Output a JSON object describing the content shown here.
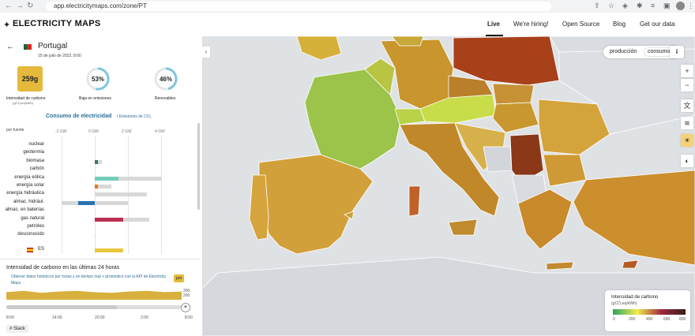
{
  "browser": {
    "url": "app.electricitymaps.com/zone/PT"
  },
  "topnav": {
    "logo": "ELECTRICITY MAPS",
    "links": [
      "Live",
      "We're hiring!",
      "Open Source",
      "Blog",
      "Get our data"
    ]
  },
  "zone": {
    "name": "Portugal",
    "date": "15 de julio de 2022, 8:00"
  },
  "metrics": {
    "carbon_value": "259g",
    "carbon_label": "Intensidad de carbono",
    "carbon_unit": "(gCO₂eq/kWh)",
    "lowcarbon_value": "53%",
    "lowcarbon_label": "Baja en emisiones",
    "lowcarbon_fraction": 0.53,
    "renewable_value": "46%",
    "renewable_label": "Renovables",
    "renewable_fraction": 0.46
  },
  "consumption": {
    "title": "Consumo de electricidad",
    "emissions_link": "| Emisiones de CO₂",
    "by_source": "por fuente",
    "ticks": [
      "-2 GW",
      "0 GW",
      "2 GW",
      "4 GW"
    ],
    "sources": [
      {
        "label": "nuclear",
        "value": 0,
        "capacity": 0,
        "color": "#888"
      },
      {
        "label": "geotermia",
        "value": 0,
        "capacity": 0,
        "color": "#888"
      },
      {
        "label": "biomasa",
        "value": 0.2,
        "capacity": 0.45,
        "color": "#3d7a5f"
      },
      {
        "label": "carbón",
        "value": 0,
        "capacity": 0,
        "color": "#888"
      },
      {
        "label": "energía eólica",
        "value": 1.45,
        "capacity": 4.0,
        "color": "#74cdb9"
      },
      {
        "label": "energía solar",
        "value": 0.18,
        "capacity": 1.0,
        "color": "#f27406"
      },
      {
        "label": "energía hidráulica",
        "value": 0,
        "capacity": 3.15,
        "color": "#2772b2"
      },
      {
        "label": "almac. hidrául.",
        "value": -1.0,
        "capacity": 2.0,
        "neg_capacity": -2.0,
        "color": "#2772b2"
      },
      {
        "label": "almac. en baterías",
        "value": 0,
        "capacity": 0,
        "color": "#888"
      },
      {
        "label": "gas natural",
        "value": 1.7,
        "capacity": 3.3,
        "color": "#bb2f51"
      },
      {
        "label": "petróleo",
        "value": 0,
        "capacity": 0,
        "color": "#888"
      },
      {
        "label": "desconocido",
        "value": 0,
        "capacity": 0.05,
        "color": "#888"
      }
    ],
    "import_label": "ES",
    "import_value": 1.7
  },
  "history": {
    "title": "Intensidad de carbono en las últimas 24 horas",
    "api_text": "Obtener datos históricos por horas y en tiempo real + pronóstico con la API de Electricity Maps",
    "pro_badge": "pro",
    "y_ticks": [
      "300",
      "200"
    ],
    "time_ticks": [
      "8:00",
      "14:00",
      "20:00",
      "2:00",
      "8:00"
    ]
  },
  "slack": "Slack",
  "map_toggle": {
    "options": [
      "producción",
      "consumo"
    ],
    "selected": "consumo"
  },
  "legend": {
    "title": "Intensidad de carbono",
    "unit": "(gCO₂eq/kWh)",
    "ticks": [
      "0",
      "200",
      "400",
      "600",
      "800"
    ]
  },
  "colors": {
    "accent": "#e4b93c",
    "ring": "#7fc6e0",
    "map_water": "#dfe2e5"
  }
}
